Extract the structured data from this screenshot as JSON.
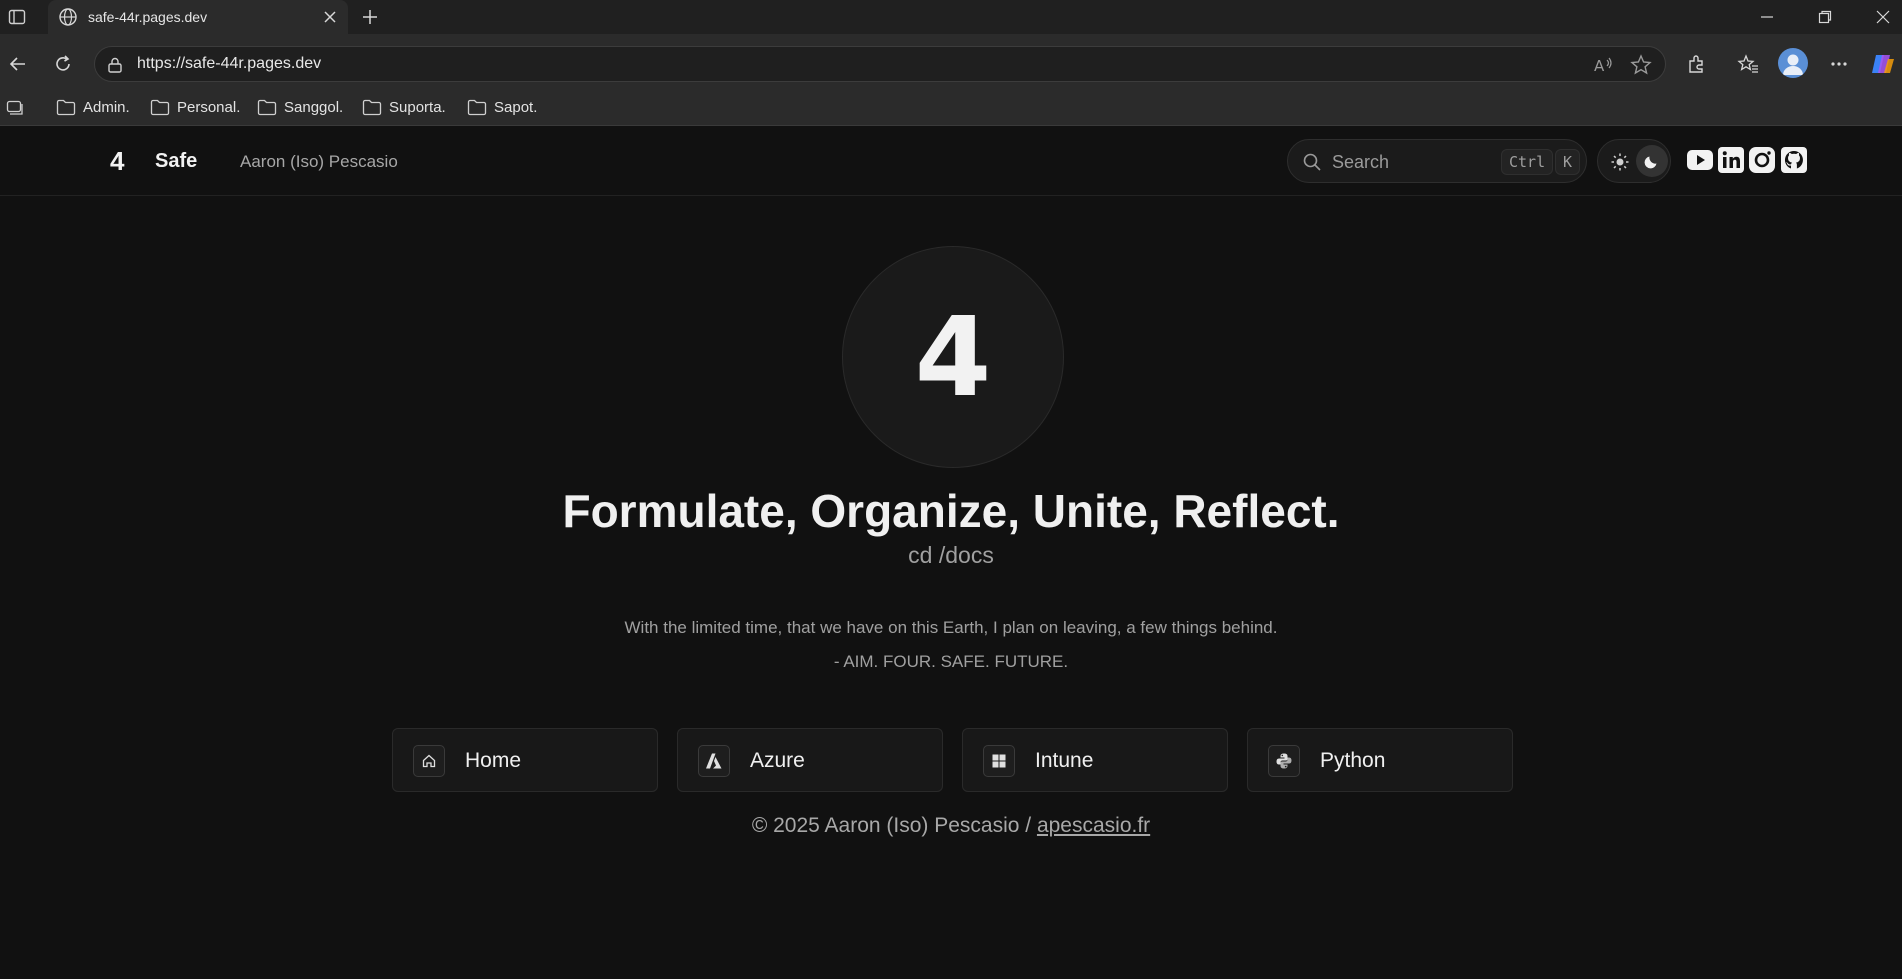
{
  "browser": {
    "tab_title": "safe-44r.pages.dev",
    "url": "https://safe-44r.pages.dev",
    "bookmarks": [
      "Admin.",
      "Personal.",
      "Sanggol.",
      "Suporta.",
      "Sapot."
    ]
  },
  "header": {
    "logo": "4",
    "site_name": "Safe",
    "author": "Aaron (Iso) Pescasio",
    "search_placeholder": "Search",
    "kbd_ctrl": "Ctrl",
    "kbd_k": "K"
  },
  "hero": {
    "logo": "4",
    "tagline": "Formulate, Organize, Unite, Reflect.",
    "subtitle": "cd /docs",
    "quote": "With the limited time, that we have on this Earth, I plan on leaving, a few things behind.",
    "quote_sign": "- AIM. FOUR. SAFE. FUTURE."
  },
  "cards": [
    {
      "label": "Home",
      "icon": "home-icon"
    },
    {
      "label": "Azure",
      "icon": "azure-icon"
    },
    {
      "label": "Intune",
      "icon": "windows-icon"
    },
    {
      "label": "Python",
      "icon": "python-icon"
    }
  ],
  "footer": {
    "text": "© 2025 Aaron (Iso) Pescasio / ",
    "link": "apescasio.fr"
  }
}
